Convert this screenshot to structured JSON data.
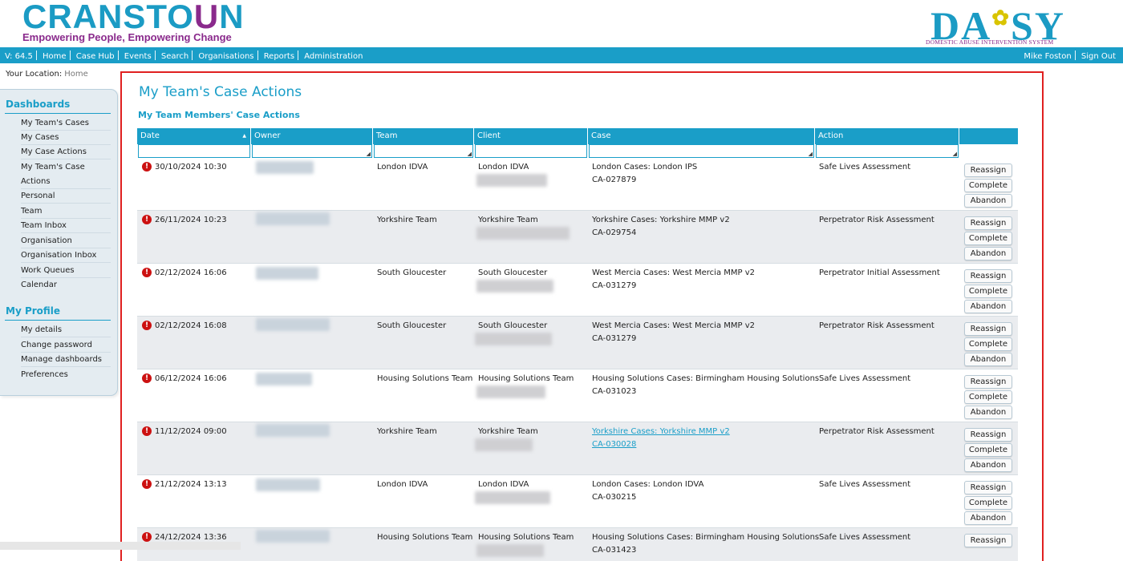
{
  "brand": {
    "logo_part1": "CRANSTO",
    "logo_part2": "U",
    "logo_part3": "N",
    "tagline": "Empowering People, Empowering Change"
  },
  "system_logo": {
    "name_part1": "DA",
    "name_flower": "✿",
    "name_part2": "SY",
    "subtitle": "DOMESTIC ABUSE INTERVENTION SYSTEM"
  },
  "nav": {
    "version": "V: 64.5",
    "items": [
      "Home",
      "Case Hub",
      "Events",
      "Search",
      "Organisations",
      "Reports",
      "Administration"
    ],
    "user": "Mike Foston",
    "sign_out": "Sign Out"
  },
  "location": {
    "label": "Your Location:",
    "value": "Home"
  },
  "sidebar": {
    "dashboards_title": "Dashboards",
    "dashboards": [
      "My Team's Cases",
      "My Cases",
      "My Case Actions",
      "My Team's Case",
      "Actions",
      "Personal",
      "Team",
      "Team Inbox",
      "Organisation",
      "Organisation Inbox",
      "Work Queues",
      "Calendar"
    ],
    "profile_title": "My Profile",
    "profile": [
      "My details",
      "Change password",
      "Manage dashboards",
      "Preferences"
    ]
  },
  "page": {
    "title": "My Team's Case Actions",
    "subtitle": "My Team Members' Case Actions"
  },
  "table": {
    "headers": [
      "Date",
      "Owner",
      "Team",
      "Client",
      "Case",
      "Action"
    ],
    "buttons": {
      "reassign": "Reassign",
      "complete": "Complete",
      "abandon": "Abandon"
    },
    "rows": [
      {
        "date": "30/10/2024 10:30",
        "team": "London IDVA",
        "client": "London IDVA",
        "case": "London Cases: London IPS",
        "case_id": "CA-027879",
        "action": "Safe Lives Assessment"
      },
      {
        "date": "26/11/2024 10:23",
        "team": "Yorkshire Team",
        "client": "Yorkshire Team",
        "case": "Yorkshire Cases: Yorkshire MMP v2",
        "case_id": "CA-029754",
        "action": "Perpetrator Risk Assessment"
      },
      {
        "date": "02/12/2024 16:06",
        "team": "South Gloucester",
        "client": "South Gloucester",
        "case": "West Mercia Cases: West Mercia MMP v2",
        "case_id": "CA-031279",
        "action": "Perpetrator Initial Assessment"
      },
      {
        "date": "02/12/2024 16:08",
        "team": "South Gloucester",
        "client": "South Gloucester",
        "case": "West Mercia Cases: West Mercia MMP v2",
        "case_id": "CA-031279",
        "action": "Perpetrator Risk Assessment"
      },
      {
        "date": "06/12/2024 16:06",
        "team": "Housing Solutions Team",
        "client": "Housing Solutions Team",
        "case": "Housing Solutions Cases: Birmingham Housing Solutions",
        "case_id": "CA-031023",
        "action": "Safe Lives Assessment"
      },
      {
        "date": "11/12/2024 09:00",
        "team": "Yorkshire Team",
        "client": "Yorkshire Team",
        "case": "Yorkshire Cases: Yorkshire MMP v2",
        "case_id": "CA-030028",
        "action": "Perpetrator Risk Assessment"
      },
      {
        "date": "21/12/2024 13:13",
        "team": "London IDVA",
        "client": "London IDVA",
        "case": "London Cases: London IDVA",
        "case_id": "CA-030215",
        "action": "Safe Lives Assessment"
      },
      {
        "date": "24/12/2024 13:36",
        "team": "Housing Solutions Team",
        "client": "Housing Solutions Team",
        "case": "Housing Solutions Cases: Birmingham Housing Solutions",
        "case_id": "CA-031423",
        "action": "Safe Lives Assessment"
      }
    ]
  },
  "colors": {
    "primary": "#1a9ec8",
    "brand_purple": "#8a2a8c",
    "alert": "#cc1111",
    "highlight_border": "#e02020"
  }
}
